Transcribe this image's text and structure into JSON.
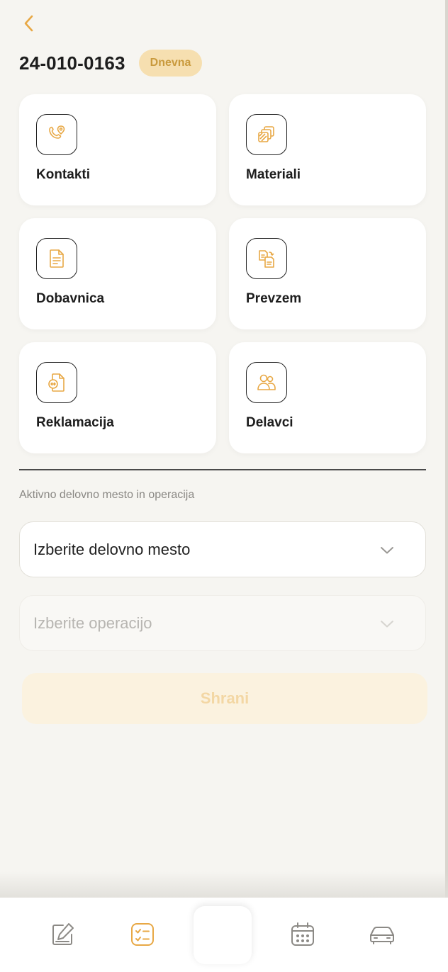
{
  "header": {
    "order_number": "24-010-0163",
    "badge": "Dnevna"
  },
  "cards": [
    {
      "label": "Kontakti",
      "icon": "phone-location-icon"
    },
    {
      "label": "Materiali",
      "icon": "layers-icon"
    },
    {
      "label": "Dobavnica",
      "icon": "document-icon"
    },
    {
      "label": "Prevzem",
      "icon": "document-transfer-icon"
    },
    {
      "label": "Reklamacija",
      "icon": "document-exchange-icon"
    },
    {
      "label": "Delavci",
      "icon": "users-icon"
    }
  ],
  "section": {
    "label": "Aktivno delovno mesto in operacija"
  },
  "workplace_select": {
    "value": "Izberite delovno mesto"
  },
  "operation_select": {
    "value": "Izberite operacijo"
  },
  "save_label": "Shrani",
  "tabbar": {
    "items": [
      {
        "icon": "edit-icon",
        "active": false
      },
      {
        "icon": "checklist-icon",
        "active": true
      },
      {
        "icon": "calendar-icon",
        "active": false
      },
      {
        "icon": "car-icon",
        "active": false
      }
    ]
  },
  "colors": {
    "accent": "#e8a845",
    "badge_bg": "#f6dfb0",
    "background": "#f6f5f1"
  }
}
